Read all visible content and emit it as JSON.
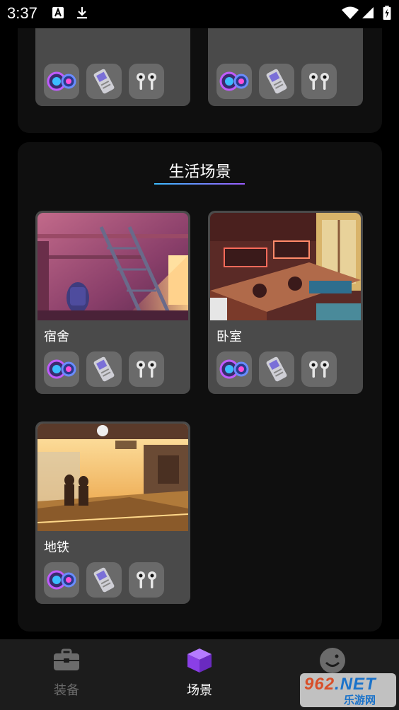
{
  "status_bar": {
    "time": "3:37",
    "icons": [
      "a-box-icon",
      "download-icon",
      "wifi-icon",
      "signal-icon",
      "battery-icon"
    ]
  },
  "previous_section": {
    "cards": [
      {
        "gear": [
          "lens-gear",
          "player-gear",
          "earbuds-gear"
        ]
      },
      {
        "gear": [
          "lens-gear",
          "player-gear",
          "earbuds-gear"
        ]
      }
    ]
  },
  "life_section": {
    "title": "生活场景",
    "cards": [
      {
        "name": "宿舍",
        "scene": "dorm",
        "gear": [
          "lens-gear",
          "player-gear",
          "earbuds-gear"
        ]
      },
      {
        "name": "卧室",
        "scene": "bedroom",
        "gear": [
          "lens-gear",
          "player-gear",
          "earbuds-gear"
        ]
      },
      {
        "name": "地铁",
        "scene": "subway",
        "gear": [
          "lens-gear",
          "player-gear",
          "earbuds-gear"
        ]
      }
    ]
  },
  "bottom_nav": {
    "tabs": [
      {
        "label": "装备",
        "icon": "briefcase-icon",
        "active": false
      },
      {
        "label": "场景",
        "icon": "cube-icon",
        "active": true
      },
      {
        "label": "",
        "icon": "smiley-icon",
        "active": false
      }
    ]
  },
  "watermark": {
    "main": "962",
    "net": ".NET",
    "sub": "乐游网"
  },
  "colors": {
    "background": "#000000",
    "section": "#0f0f0f",
    "card": "#4a4a4a",
    "accent": "#9b5cff",
    "underline_start": "#3bbcff",
    "underline_end": "#9b5cff",
    "inactive_tab": "#6b6b6b"
  }
}
